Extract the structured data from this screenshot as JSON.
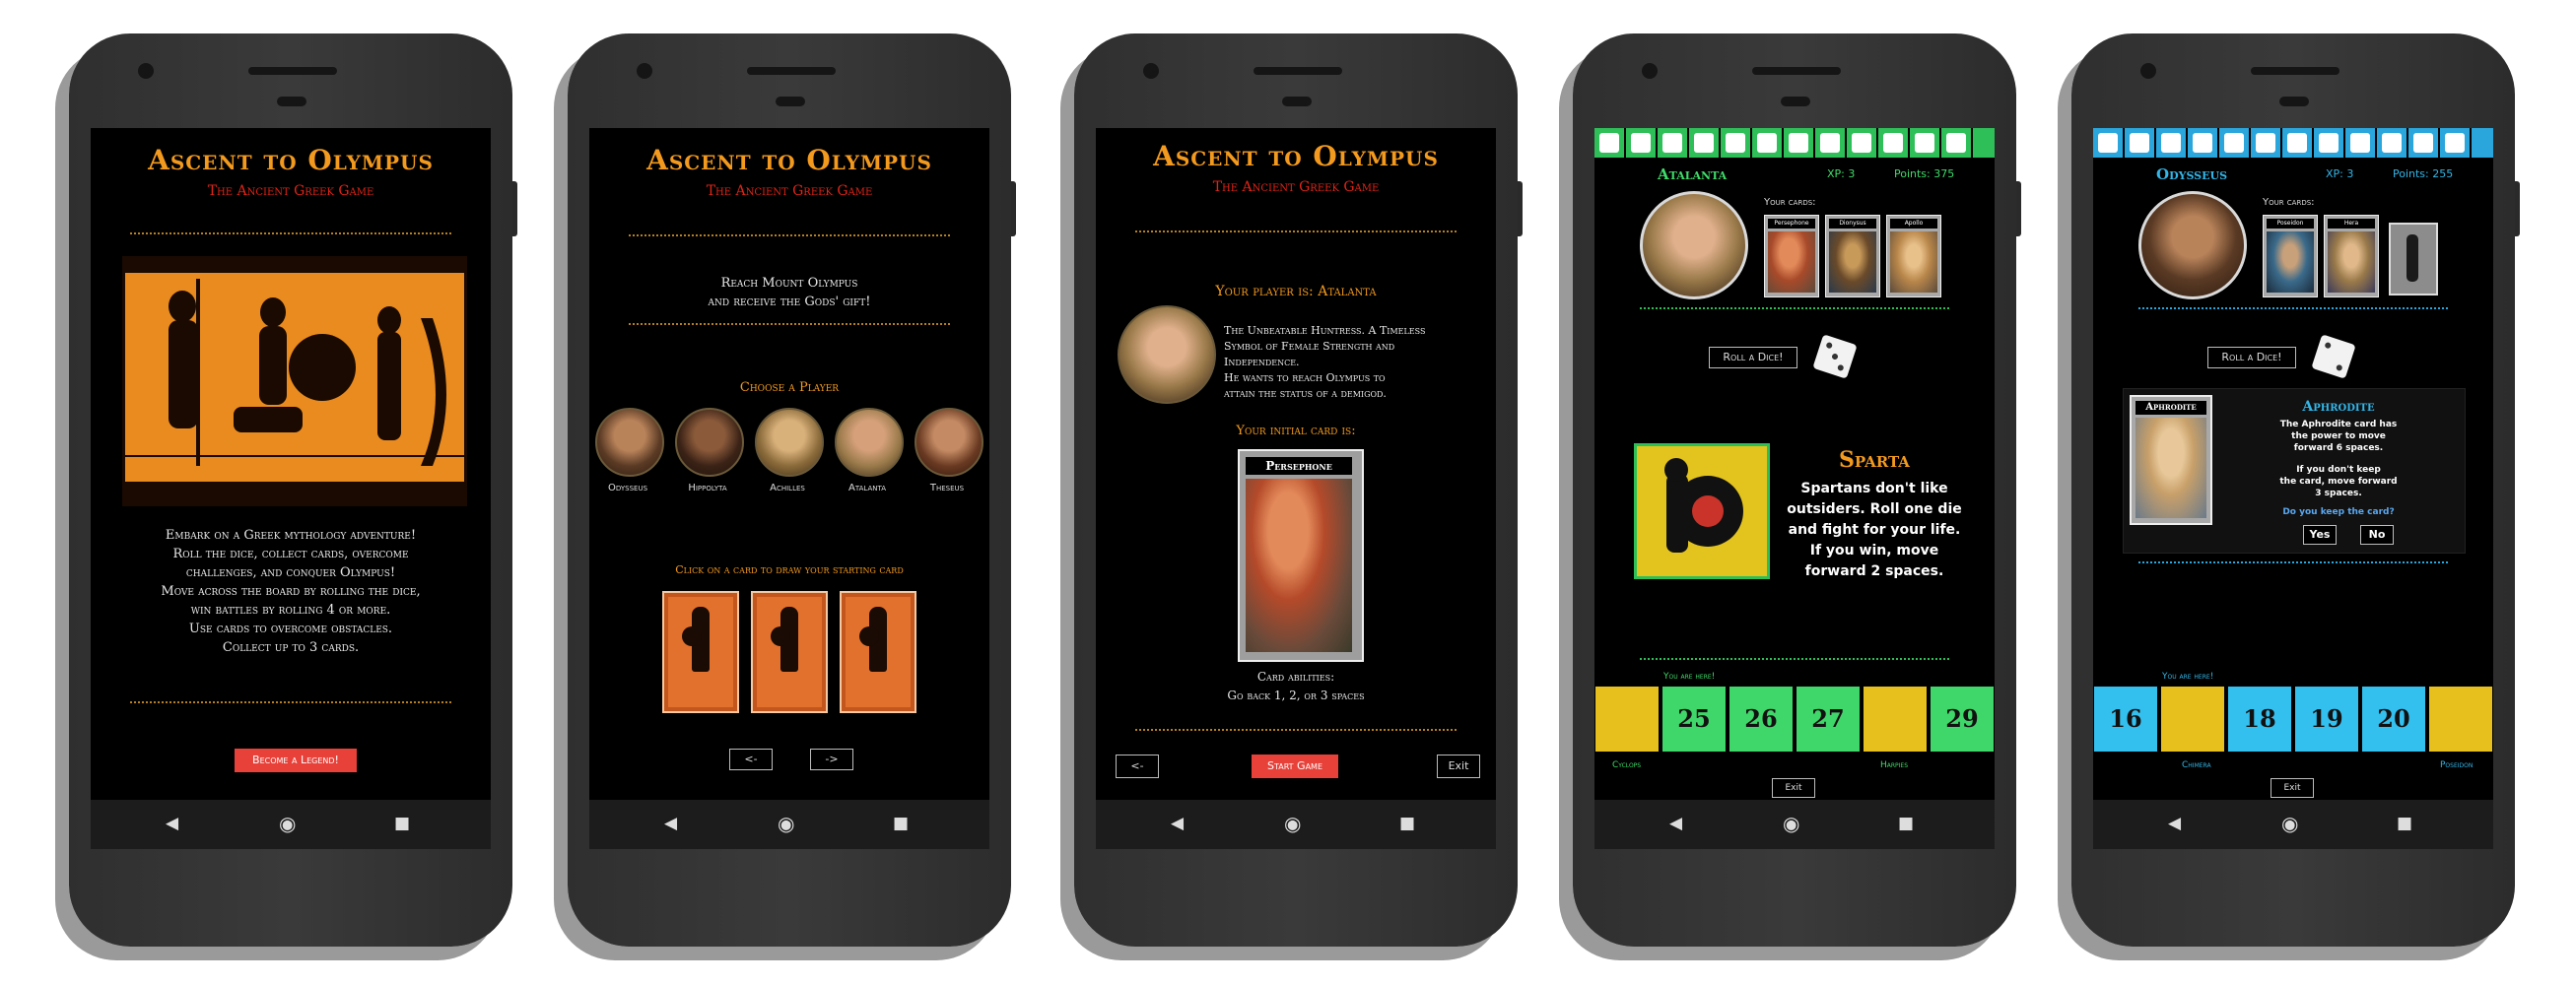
{
  "brand": {
    "title": "Ascent to Olympus",
    "subtitle": "The Ancient Greek Game"
  },
  "colors": {
    "accent": "#f39a1e",
    "red": "#e02418",
    "green": "#3fdc6a",
    "cyan": "#33b6e8"
  },
  "screen1": {
    "intro_lines": [
      "Embark on a Greek mythology adventure!",
      "Roll the dice, collect cards, overcome",
      "challenges, and conquer Olympus!",
      "Move across the board by rolling the dice,",
      "win battles by rolling 4 or more.",
      "Use cards to overcome obstacles.",
      "Collect up to 3 cards."
    ],
    "cta": "Become a Legend!"
  },
  "screen2": {
    "goal_lines": [
      "Reach Mount Olympus",
      "and receive the Gods' gift!"
    ],
    "choose_label": "Choose a Player",
    "players": [
      "Odysseus",
      "Hippolyta",
      "Achilles",
      "Atalanta",
      "Theseus"
    ],
    "draw_label": "Click on a card to draw your starting card",
    "prev": "<-",
    "next": "->"
  },
  "screen3": {
    "player_label": "Your player is: Atalanta",
    "bio_lines": [
      "The Unbeatable Huntress. A Timeless",
      "Symbol of Female Strength and",
      "Independence.",
      "He wants to reach Olympus to",
      "attain the status of a demigod."
    ],
    "initial_label": "Your initial card is:",
    "card_title": "Persephone",
    "abilities_lines": [
      "Card abilities:",
      "Go back 1, 2, or 3 spaces"
    ],
    "back": "<-",
    "start": "Start Game",
    "exit": "Exit"
  },
  "screen4": {
    "name": "Atalanta",
    "xp": "XP: 3",
    "points": "Points: 375",
    "cards_label": "Your cards:",
    "cards": [
      "Persephone",
      "Dionysus",
      "Apollo"
    ],
    "roll": "Roll a Dice!",
    "event_title": "Sparta",
    "event_lines": [
      "Spartans don't like",
      "outsiders. Roll one die",
      "and fight for your life.",
      "If you win, move",
      "forward 2 spaces."
    ],
    "here": "You are here!",
    "board": [
      "",
      "25",
      "26",
      "27",
      "",
      "29"
    ],
    "board_left_label": "Cyclops",
    "board_right_label": "Harpies",
    "exit": "Exit"
  },
  "screen5": {
    "name": "Odysseus",
    "xp": "XP: 3",
    "points": "Points: 255",
    "cards_label": "Your cards:",
    "cards": [
      "Poseidon",
      "Hera"
    ],
    "roll": "Roll a Dice!",
    "card_title": "Aphrodite",
    "popup_title": "Aphrodite",
    "popup_lines": [
      "The Aphrodite card has",
      "the power to move",
      "forward 6 spaces."
    ],
    "popup_lines2": [
      "If you don't keep",
      "the card, move forward",
      "3 spaces."
    ],
    "question": "Do you keep the card?",
    "yes": "Yes",
    "no": "No",
    "here": "You are here!",
    "board": [
      "16",
      "",
      "18",
      "19",
      "20",
      ""
    ],
    "board_left_label": "Chimera",
    "board_right_label": "Poseidon",
    "exit": "Exit"
  }
}
